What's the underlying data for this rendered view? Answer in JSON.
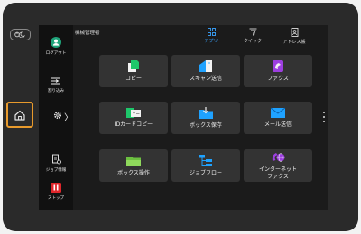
{
  "header": {
    "admin_label": "機械管理者"
  },
  "sidebar": {
    "logout": "ログアウト",
    "interrupt": "割り込み",
    "job_status": "ジョブ情報",
    "stop": "ストップ",
    "settings_chevron": "〉"
  },
  "topnav": [
    {
      "label": "アプリ",
      "active": true
    },
    {
      "label": "クイック",
      "active": false
    },
    {
      "label": "アドレス帳",
      "active": false
    }
  ],
  "tiles": [
    {
      "label": "コピー"
    },
    {
      "label": "スキャン送信"
    },
    {
      "label": "ファクス"
    },
    {
      "label": "IDカードコピー"
    },
    {
      "label": "ボックス保存"
    },
    {
      "label": "メール送信"
    },
    {
      "label": "ボックス操作"
    },
    {
      "label": "ジョブフロー"
    },
    {
      "label_line1": "インターネット",
      "label_line2": "ファクス"
    }
  ],
  "colors": {
    "accent": "#3aa3ff",
    "home_highlight": "#e89a2c",
    "stop_red": "#e0262b",
    "logout_green": "#1fa37a"
  }
}
